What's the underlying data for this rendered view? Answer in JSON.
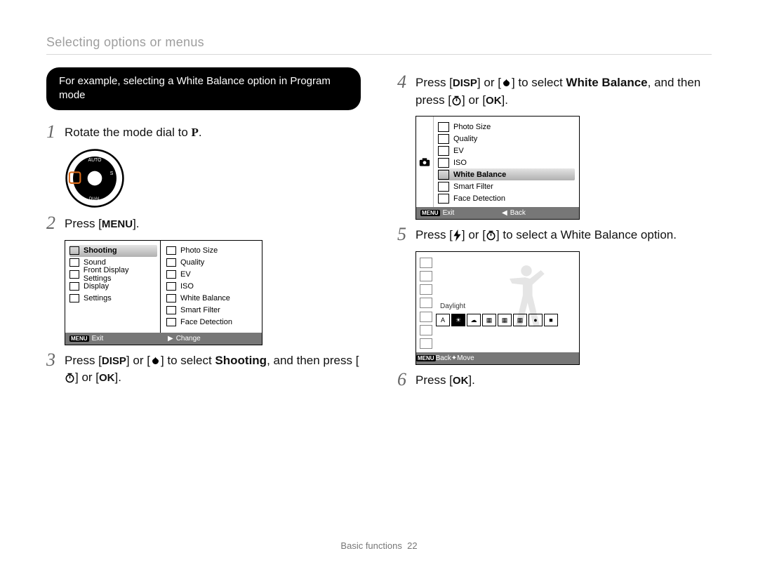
{
  "breadcrumb": "Selecting options or menus",
  "pill": "For example, selecting a White Balance option in Program mode",
  "keys": {
    "DISP": "DISP",
    "MENU": "MENU",
    "OK": "OK",
    "P": "P"
  },
  "steps": {
    "s1": {
      "num": "1",
      "pre": "Rotate the mode dial to ",
      "post": "."
    },
    "s2": {
      "num": "2",
      "pre": "Press [",
      "post": "]."
    },
    "s3": {
      "num": "3",
      "pre": "Press [",
      "mid1": "] or [",
      "mid2": "] to select ",
      "bold": "Shooting",
      "mid3": ", and then press [",
      "mid4": "] or [",
      "post": "]."
    },
    "s4": {
      "num": "4",
      "pre": "Press [",
      "mid1": "] or [",
      "mid2": "] to select ",
      "bold": "White Balance",
      "mid3": ", and then press [",
      "mid4": "] or [",
      "post": "]."
    },
    "s5": {
      "num": "5",
      "pre": "Press [",
      "mid1": "] or [",
      "post": "] to select a White Balance option."
    },
    "s6": {
      "num": "6",
      "pre": "Press [",
      "post": "]."
    }
  },
  "screenA": {
    "left": [
      {
        "label": "Shooting",
        "selected": true
      },
      {
        "label": "Sound"
      },
      {
        "label": "Front Display Settings"
      },
      {
        "label": "Display"
      },
      {
        "label": "Settings"
      }
    ],
    "right": [
      "Photo Size",
      "Quality",
      "EV",
      "ISO",
      "White Balance",
      "Smart Filter",
      "Face Detection"
    ],
    "foot": {
      "leftkey": "MENU",
      "leftlabel": "Exit",
      "righticon": "▶",
      "rightlabel": "Change"
    }
  },
  "screenB": {
    "rows": [
      {
        "label": "Photo Size"
      },
      {
        "label": "Quality"
      },
      {
        "label": "EV"
      },
      {
        "label": "ISO"
      },
      {
        "label": "White Balance",
        "selected": true
      },
      {
        "label": "Smart Filter"
      },
      {
        "label": "Face Detection"
      }
    ],
    "foot": {
      "leftkey": "MENU",
      "leftlabel": "Exit",
      "righticon": "◀",
      "rightlabel": "Back"
    }
  },
  "screenC": {
    "midlabel": "Daylight",
    "strip": [
      "A",
      "☀",
      "☁",
      "▦",
      "▦",
      "▦",
      "●",
      "■"
    ],
    "selectedIndex": 1,
    "foot": {
      "leftkey": "MENU",
      "leftlabel": "Back",
      "righticon": "✦",
      "rightlabel": "Move"
    }
  },
  "footer": {
    "section": "Basic functions",
    "page": "22"
  }
}
